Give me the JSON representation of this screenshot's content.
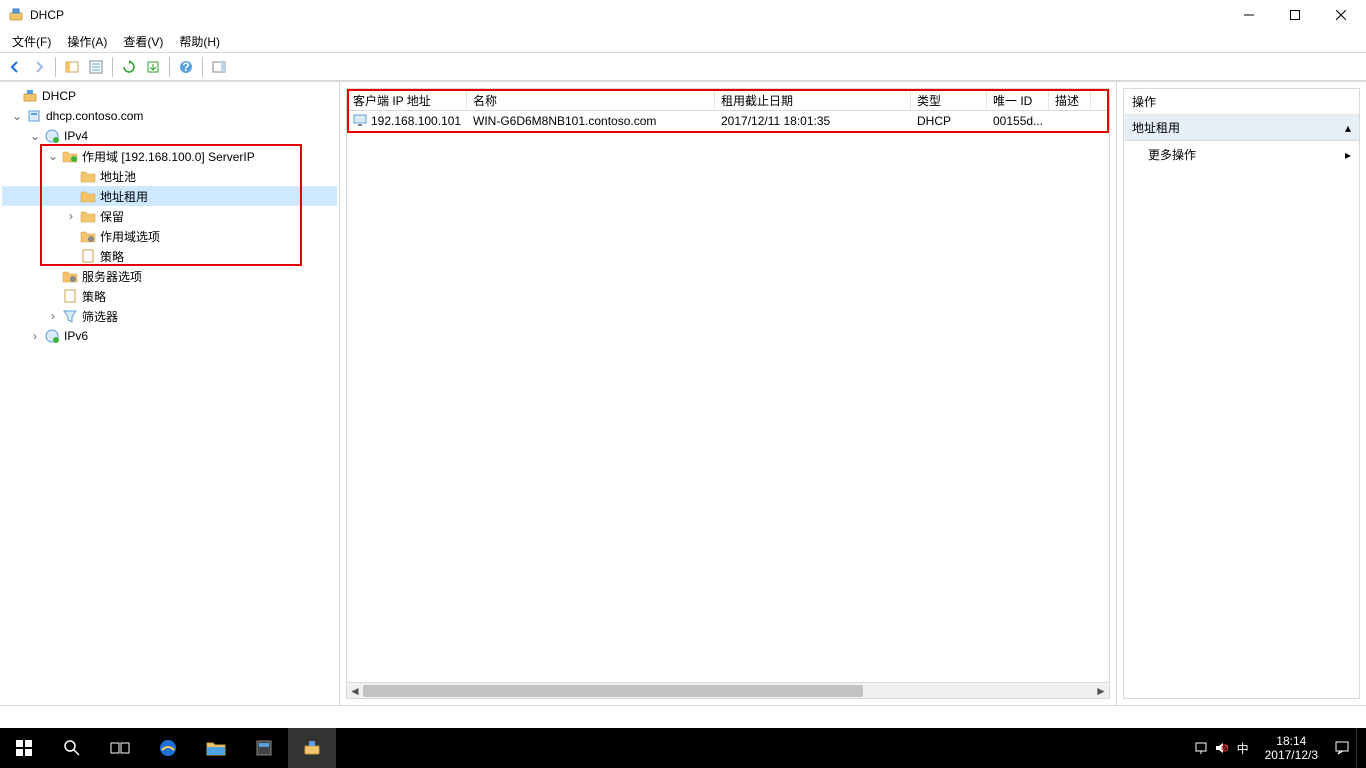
{
  "titlebar": {
    "title": "DHCP"
  },
  "menus": {
    "file": "文件(F)",
    "action": "操作(A)",
    "view": "查看(V)",
    "help": "帮助(H)"
  },
  "tree": {
    "root": "DHCP",
    "server": "dhcp.contoso.com",
    "ipv4": "IPv4",
    "scope": "作用域 [192.168.100.0] ServerIP",
    "pool": "地址池",
    "leases": "地址租用",
    "reservations": "保留",
    "scope_options": "作用域选项",
    "policies": "策略",
    "server_options": "服务器选项",
    "policies2": "策略",
    "filters": "筛选器",
    "ipv6": "IPv6"
  },
  "columns": {
    "client_ip": "客户端 IP 地址",
    "name": "名称",
    "lease_exp": "租用截止日期",
    "type": "类型",
    "unique_id": "唯一 ID",
    "description": "描述"
  },
  "row": {
    "ip": "192.168.100.101",
    "name": "WIN-G6D6M8NB101.contoso.com",
    "exp": "2017/12/11 18:01:35",
    "type": "DHCP",
    "uid": "00155d...",
    "desc": ""
  },
  "actions": {
    "title": "操作",
    "section": "地址租用",
    "more": "更多操作"
  },
  "taskbar": {
    "time": "18:14",
    "date": "2017/12/3",
    "ime": "中"
  }
}
